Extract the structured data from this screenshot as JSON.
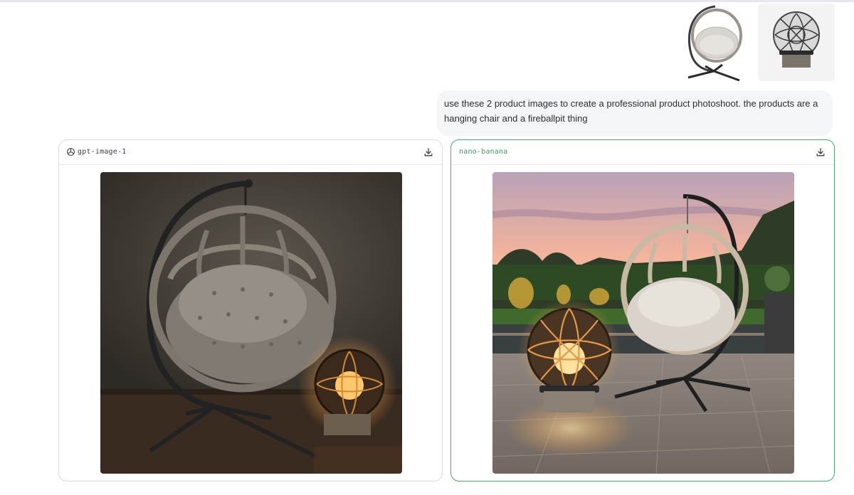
{
  "attachments": [
    {
      "name": "hanging-chair-product-image"
    },
    {
      "name": "fireball-pit-product-image"
    }
  ],
  "message": {
    "text": "use these 2 product images to create a professional product photoshoot. the products are a hanging chair and a fireballpit thing"
  },
  "results": [
    {
      "model": "gpt-image-1",
      "icon": "openai-logo-icon",
      "download_icon": "download-icon",
      "accent": "#3c4048"
    },
    {
      "model": "nano-banana",
      "icon": "",
      "download_icon": "download-icon",
      "accent": "#4fa872"
    }
  ]
}
